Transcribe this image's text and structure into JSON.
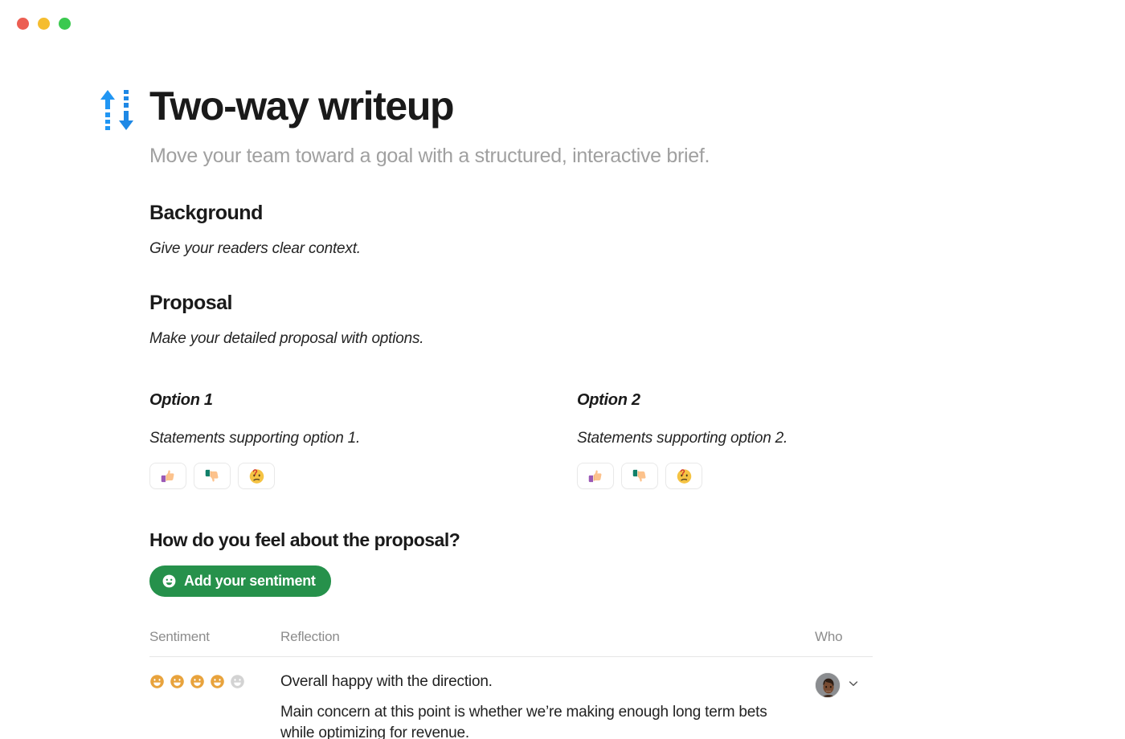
{
  "window": {
    "traffic_lights": [
      {
        "name": "close",
        "color": "#ec5e52"
      },
      {
        "name": "minimize",
        "color": "#f5bd2f"
      },
      {
        "name": "zoom",
        "color": "#3bc94f"
      }
    ]
  },
  "header": {
    "icon": "up-down-arrow-icon",
    "title": "Two-way writeup",
    "subtitle": "Move your team toward a goal with a structured, interactive brief."
  },
  "sections": [
    {
      "id": "background",
      "title": "Background",
      "description": "Give your readers clear context."
    },
    {
      "id": "proposal",
      "title": "Proposal",
      "description": "Make your detailed proposal with options."
    }
  ],
  "options": [
    {
      "title": "Option 1",
      "description": "Statements supporting option 1.",
      "reactions": [
        "thumbs-up-emoji",
        "thumbs-down-emoji",
        "thinking-face-emoji"
      ]
    },
    {
      "title": "Option 2",
      "description": "Statements supporting option 2.",
      "reactions": [
        "thumbs-up-emoji",
        "thumbs-down-emoji",
        "thinking-face-emoji"
      ]
    }
  ],
  "sentiment": {
    "question": "How do you feel about the proposal?",
    "button_label": "Add your sentiment",
    "button_icon": "smiley-face-icon",
    "button_color": "#26914b"
  },
  "table": {
    "columns": [
      "Sentiment",
      "Reflection",
      "Who"
    ],
    "rows": [
      {
        "sentiment_filled": 4,
        "sentiment_total": 5,
        "reflection": [
          "Overall happy with the direction.",
          "Main concern at this point is whether we’re making enough long term bets while optimizing for revenue."
        ],
        "who_avatar": "user-avatar",
        "who_menu": "chevron-down-icon"
      }
    ]
  },
  "colors": {
    "accent_blue": "#2196f3",
    "sentiment_active": "#e8a33d",
    "sentiment_inactive": "#d3d3d3",
    "text_primary": "#1a1a1a",
    "text_muted": "#a0a0a0"
  }
}
